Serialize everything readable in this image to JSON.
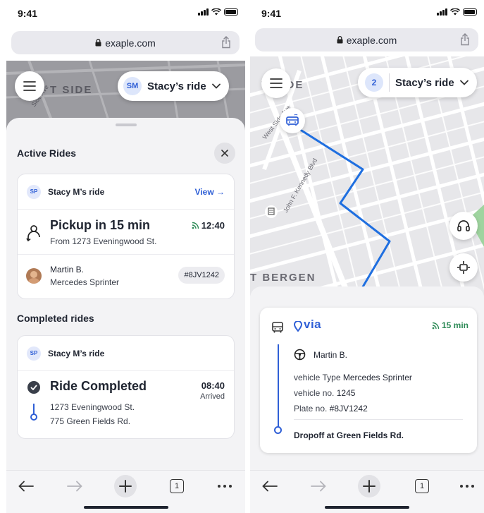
{
  "status": {
    "time": "9:41"
  },
  "browser": {
    "url": "exaple.com",
    "tab_count": "1"
  },
  "left": {
    "map_label": "T SIDE",
    "street_label": "Side Ave",
    "ride_pill": {
      "initials": "SM",
      "title": "Stacy’s ride"
    },
    "active": {
      "heading": "Active Rides",
      "card": {
        "badge": "SP",
        "name": "Stacy M’s ride",
        "view_label": "View →",
        "status": "Pickup in 15 min",
        "from": "From 1273 Eveningwood St.",
        "eta": "12:40",
        "driver_name": "Martin B.",
        "vehicle": "Mercedes Sprinter",
        "plate": "#8JV1242"
      }
    },
    "completed": {
      "heading": "Completed rides",
      "card": {
        "badge": "SP",
        "name": "Stacy M’s ride",
        "status": "Ride Completed",
        "time": "08:40",
        "time_note": "Arrived",
        "from": "1273 Eveningwood St.",
        "to": "775 Green Fields Rd."
      }
    }
  },
  "right": {
    "ride_pill": {
      "count": "2",
      "title": "Stacy’s ride"
    },
    "map_labels": {
      "area_top": "T SIDE",
      "area_bottom": "T BERGEN",
      "street_1": "West Side Ave",
      "street_2": "John F. Kennedy Blvd"
    },
    "trip": {
      "brand": "via",
      "eta": "15 min",
      "driver": "Martin B.",
      "type_label": "vehicle Type",
      "type_value": "Mercedes Sprinter",
      "no_label": "vehicle no.",
      "no_value": "1245",
      "plate_label": "Plate no.",
      "plate_value": "#8JV1242",
      "dropoff": "Dropoff at Green Fields Rd."
    }
  },
  "colors": {
    "accent": "#2f5fd6",
    "eta_green": "#2e8b57"
  }
}
